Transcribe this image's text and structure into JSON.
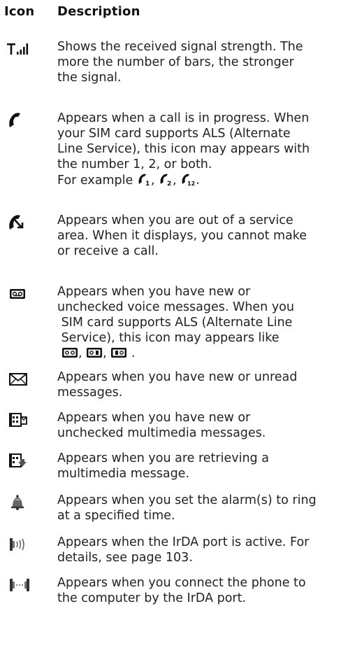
{
  "header": {
    "icon": "Icon",
    "description": "Description"
  },
  "rows": [
    {
      "icon": "signal-strength-icon",
      "lines": [
        "Shows the received signal strength. The",
        "more the number of bars, the stronger",
        "the signal."
      ]
    },
    {
      "icon": "call-in-progress-icon",
      "lines": [
        "Appears when a call is in progress. When",
        "your SIM card supports ALS (Alternate",
        "Line Service), this icon may appears with",
        "the number 1, 2, or both."
      ],
      "example": {
        "prefix": "For example",
        "sep": ",",
        "end": ".",
        "icons": [
          "call-line-1-icon",
          "call-line-2-icon",
          "call-line-12-icon"
        ]
      }
    },
    {
      "icon": "no-service-icon",
      "lines": [
        "Appears when you are out of a service",
        "area. When it displays, you cannot make",
        "or receive a call."
      ]
    },
    {
      "icon": "voicemail-icon",
      "lines": [
        "Appears when you have new or",
        "unchecked voice messages. When you",
        " SIM card supports ALS (Alternate Line",
        " Service), this icon may appears like"
      ],
      "example": {
        "sep": ",",
        "end": ".",
        "icons": [
          "voicemail-line-both-icon",
          "voicemail-line-1-icon",
          "voicemail-line-2-icon"
        ]
      }
    },
    {
      "icon": "envelope-icon",
      "lines": [
        "Appears when you have new or unread",
        "messages."
      ]
    },
    {
      "icon": "multimedia-message-icon",
      "lines": [
        "Appears when you have new or",
        "unchecked multimedia messages."
      ]
    },
    {
      "icon": "retrieving-multimedia-icon",
      "lines": [
        "Appears when you are retrieving a",
        "multimedia message."
      ]
    },
    {
      "icon": "alarm-icon",
      "lines": [
        "Appears when you set the alarm(s) to ring",
        "at a specified time."
      ]
    },
    {
      "icon": "irda-active-icon",
      "lines": [
        "Appears when the IrDA port is active. For",
        "details, see page 103."
      ]
    },
    {
      "icon": "irda-connected-icon",
      "lines": [
        "Appears when you connect the phone to",
        "the computer by the IrDA port."
      ]
    }
  ]
}
